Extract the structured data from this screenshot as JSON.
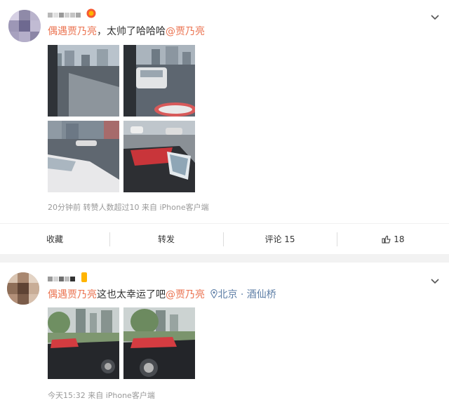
{
  "posts": [
    {
      "username": "",
      "text_parts": [
        "偶遇贾乃亮",
        "，太帅了哈哈哈",
        "@贾乃亮"
      ],
      "meta": "20分钟前  转赞人数超过10  来自 iPhone客户端",
      "actions": {
        "collect": "收藏",
        "repost": "转发",
        "comment": "评论 15",
        "like_count": "18"
      }
    },
    {
      "username": "",
      "text_parts": [
        "偶遇贾乃亮",
        "这也太幸运了吧",
        "@贾乃亮",
        "北京 · 酒仙桥"
      ],
      "meta": "今天15:32  来自 iPhone客户端"
    }
  ],
  "colors": {
    "mention": "#eb7350",
    "location": "#5d7ea6",
    "meta": "#999999",
    "separator": "#f2f2f2"
  }
}
